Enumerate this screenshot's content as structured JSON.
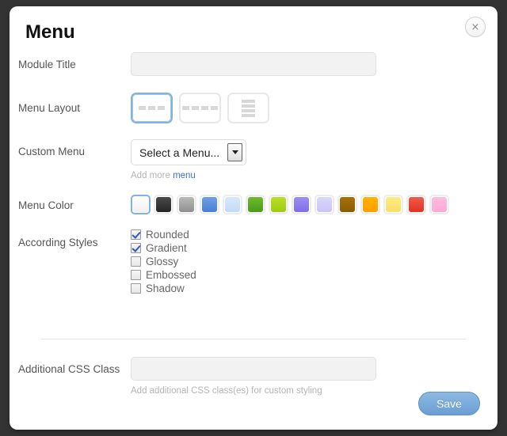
{
  "dialog": {
    "title": "Menu",
    "close_label": "×"
  },
  "fields": {
    "module_title": {
      "label": "Module Title",
      "value": "",
      "placeholder": ""
    },
    "menu_layout": {
      "label": "Menu Layout",
      "options": [
        {
          "name": "layout-horizontal-3",
          "type": "dashes",
          "count": 3,
          "selected": true
        },
        {
          "name": "layout-horizontal-4",
          "type": "dashes",
          "count": 4,
          "selected": false
        },
        {
          "name": "layout-vertical-list",
          "type": "bars",
          "count": 4,
          "selected": false
        }
      ]
    },
    "custom_menu": {
      "label": "Custom Menu",
      "selected_option": "Select a Menu...",
      "hint_prefix": "Add more ",
      "hint_link": "menu"
    },
    "menu_color": {
      "label": "Menu Color",
      "swatches": [
        {
          "name": "white",
          "color": "#ffffff",
          "color2": "#f0f0f0",
          "selected": true
        },
        {
          "name": "black",
          "color": "#4a4a4a",
          "color2": "#252525",
          "selected": false
        },
        {
          "name": "grey",
          "color": "#b9b9b9",
          "color2": "#8f8f8f",
          "selected": false
        },
        {
          "name": "blue",
          "color": "#6e9fe8",
          "color2": "#4a7fd4",
          "selected": false
        },
        {
          "name": "light-blue",
          "color": "#d9e8fb",
          "color2": "#c2daf7",
          "selected": false
        },
        {
          "name": "green",
          "color": "#6cbe2c",
          "color2": "#4a9a18",
          "selected": false
        },
        {
          "name": "lime",
          "color": "#b8e028",
          "color2": "#9ecb11",
          "selected": false
        },
        {
          "name": "purple",
          "color": "#9a8ef2",
          "color2": "#7f6ee8",
          "selected": false
        },
        {
          "name": "light-purple",
          "color": "#dbd7fb",
          "color2": "#cac4f8",
          "selected": false
        },
        {
          "name": "brown",
          "color": "#a8710a",
          "color2": "#8a5c02",
          "selected": false
        },
        {
          "name": "orange",
          "color": "#ffb300",
          "color2": "#ff9d00",
          "selected": false
        },
        {
          "name": "yellow",
          "color": "#fdeb84",
          "color2": "#f8e064",
          "selected": false
        },
        {
          "name": "red",
          "color": "#ef5b4a",
          "color2": "#e03325",
          "selected": false
        },
        {
          "name": "pink",
          "color": "#ffbde0",
          "color2": "#ffa8d6",
          "selected": false
        }
      ]
    },
    "according_styles": {
      "label": "According Styles",
      "items": [
        {
          "label": "Rounded",
          "checked": true
        },
        {
          "label": "Gradient",
          "checked": true
        },
        {
          "label": "Glossy",
          "checked": false
        },
        {
          "label": "Embossed",
          "checked": false
        },
        {
          "label": "Shadow",
          "checked": false
        }
      ]
    },
    "additional_css": {
      "label": "Additional CSS Class",
      "value": "",
      "placeholder": "",
      "hint": "Add additional CSS class(es) for custom styling"
    }
  },
  "footer": {
    "save_label": "Save"
  }
}
